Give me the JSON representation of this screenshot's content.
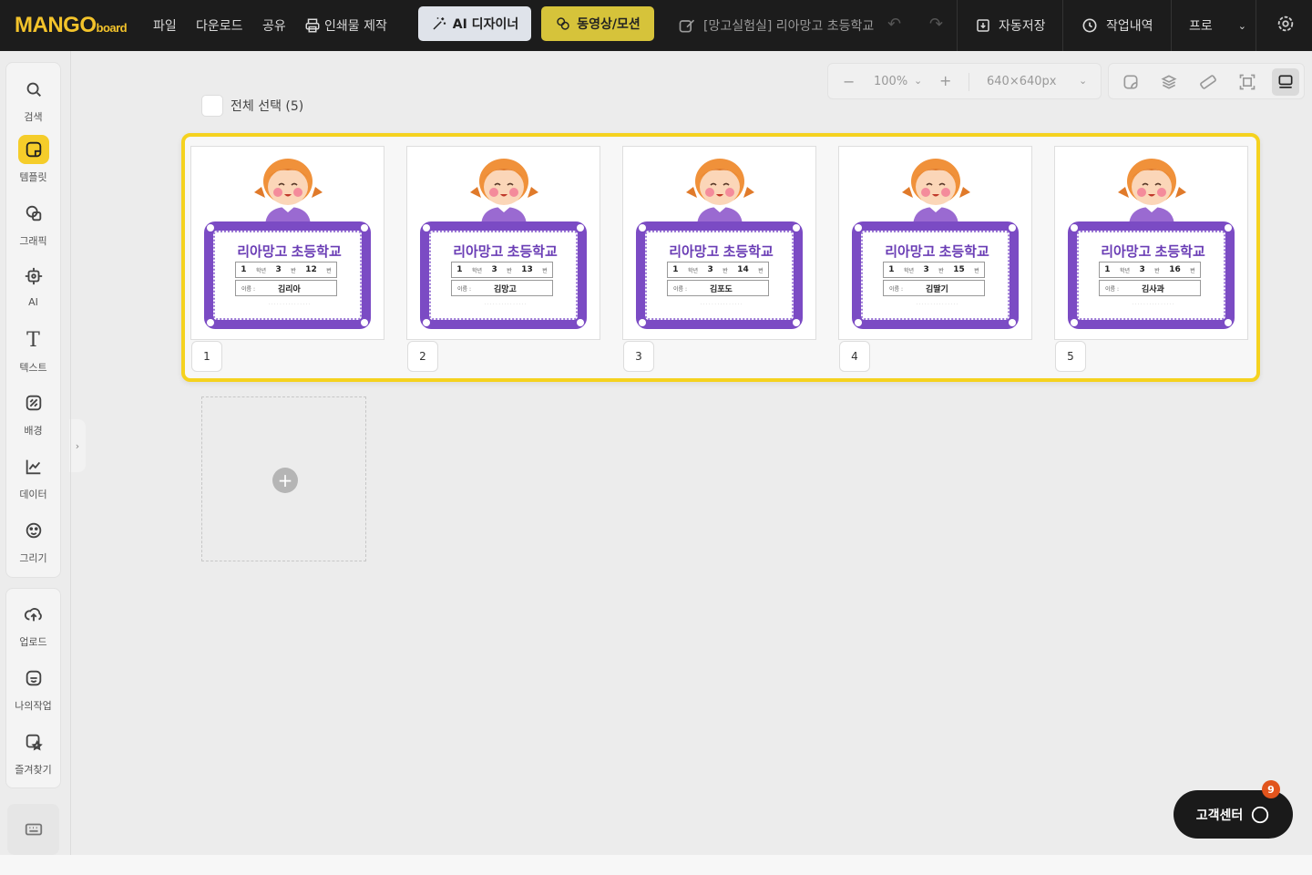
{
  "brand": {
    "logo_main": "MANGO",
    "logo_sub": "board"
  },
  "menu": {
    "file": "파일",
    "download": "다운로드",
    "share": "공유",
    "print": "인쇄물 제작"
  },
  "buttons": {
    "ai_designer": "AI 디자이너",
    "video_motion": "동영상/모션"
  },
  "document": {
    "title": "[망고실험실] 리아망고 초등학교"
  },
  "top_right": {
    "autosave": "자동저장",
    "history": "작업내역",
    "plan": "프로"
  },
  "sidebar": {
    "items": [
      {
        "label": "검색",
        "icon": "search-icon"
      },
      {
        "label": "템플릿",
        "icon": "template-icon",
        "active": true
      },
      {
        "label": "그래픽",
        "icon": "graphic-icon"
      },
      {
        "label": "AI",
        "icon": "ai-icon"
      },
      {
        "label": "텍스트",
        "icon": "text-icon"
      },
      {
        "label": "배경",
        "icon": "background-icon"
      },
      {
        "label": "데이터",
        "icon": "chart-icon"
      },
      {
        "label": "그리기",
        "icon": "draw-icon"
      }
    ],
    "items2": [
      {
        "label": "업로드",
        "icon": "upload-icon"
      },
      {
        "label": "나의작업",
        "icon": "my-work-icon"
      },
      {
        "label": "즐겨찾기",
        "icon": "favorites-icon"
      }
    ]
  },
  "zoom": {
    "level": "100%",
    "canvas_size": "640×640px"
  },
  "select_all": "전체 선택 (5)",
  "pages": [
    {
      "number": "1",
      "school": "리아망고 초등학교",
      "grade": "1",
      "grade_lbl": "학년",
      "class": "3",
      "class_lbl": "반",
      "num": "12",
      "num_lbl": "번",
      "name_lbl": "이름 :",
      "name": "김리아"
    },
    {
      "number": "2",
      "school": "리아망고 초등학교",
      "grade": "1",
      "grade_lbl": "학년",
      "class": "3",
      "class_lbl": "반",
      "num": "13",
      "num_lbl": "번",
      "name_lbl": "이름 :",
      "name": "김망고"
    },
    {
      "number": "3",
      "school": "리아망고 초등학교",
      "grade": "1",
      "grade_lbl": "학년",
      "class": "3",
      "class_lbl": "반",
      "num": "14",
      "num_lbl": "번",
      "name_lbl": "이름 :",
      "name": "김포도"
    },
    {
      "number": "4",
      "school": "리아망고 초등학교",
      "grade": "1",
      "grade_lbl": "학년",
      "class": "3",
      "class_lbl": "반",
      "num": "15",
      "num_lbl": "번",
      "name_lbl": "이름 :",
      "name": "김딸기"
    },
    {
      "number": "5",
      "school": "리아망고 초등학교",
      "grade": "1",
      "grade_lbl": "학년",
      "class": "3",
      "class_lbl": "반",
      "num": "16",
      "num_lbl": "번",
      "name_lbl": "이름 :",
      "name": "김사과"
    }
  ],
  "customer_center": {
    "label": "고객센터",
    "badge": "9"
  },
  "colors": {
    "accent_yellow": "#f5d21f",
    "tag_purple": "#7b4bc4",
    "badge": "#e1541c"
  }
}
